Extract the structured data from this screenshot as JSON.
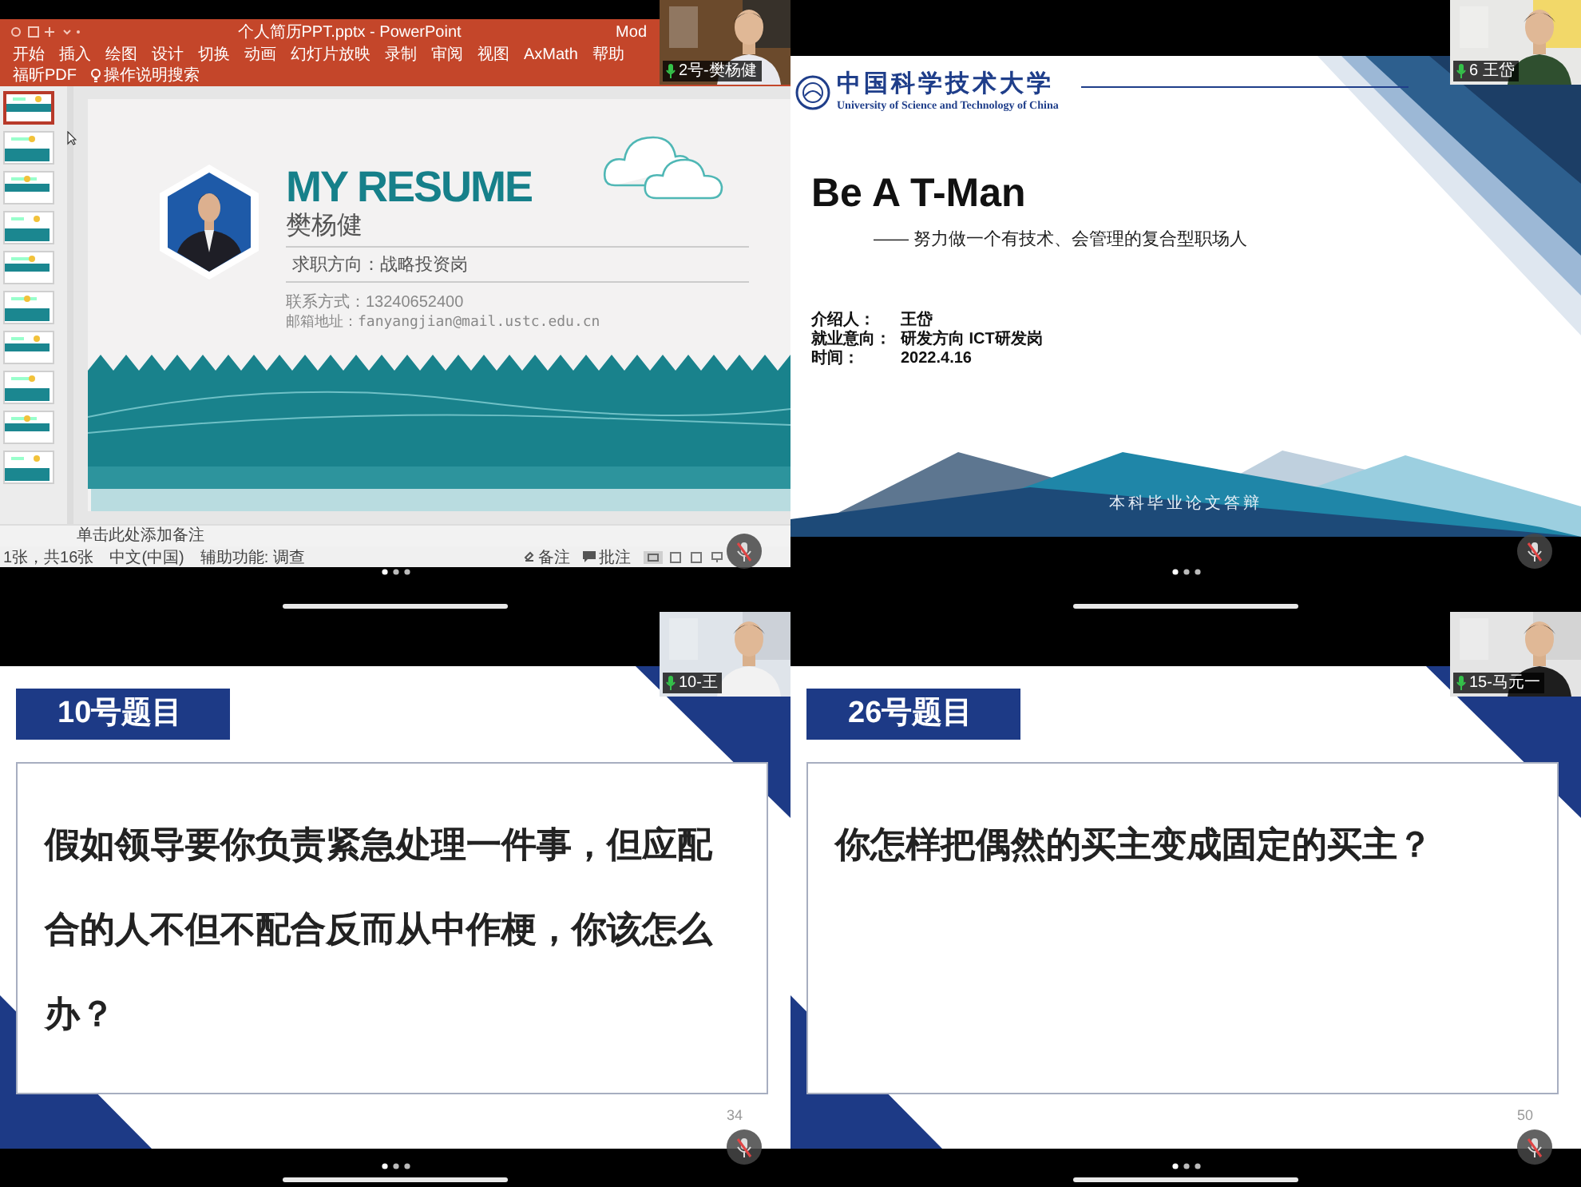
{
  "tiles": [
    {
      "kind": "powerpoint",
      "participant": {
        "name": "2号-樊杨健",
        "mic_on": true
      },
      "window": {
        "title": "个人简历PPT.pptx - PowerPoint",
        "account": "Mod"
      },
      "ribbon_tabs": [
        {
          "label": "开始",
          "kind": "tab"
        },
        {
          "label": "插入",
          "kind": "tab"
        },
        {
          "label": "绘图",
          "kind": "tab"
        },
        {
          "label": "设计",
          "kind": "tab"
        },
        {
          "label": "切换",
          "kind": "tab"
        },
        {
          "label": "动画",
          "kind": "tab"
        },
        {
          "label": "幻灯片放映",
          "kind": "tab"
        },
        {
          "label": "录制",
          "kind": "tab"
        },
        {
          "label": "审阅",
          "kind": "tab"
        },
        {
          "label": "视图",
          "kind": "tab"
        },
        {
          "label": "AxMath",
          "kind": "tab"
        },
        {
          "label": "帮助",
          "kind": "tab"
        },
        {
          "label": "福昕PDF",
          "kind": "tab"
        },
        {
          "label": "操作说明搜索",
          "kind": "search"
        }
      ],
      "slide_thumbnails": [
        {
          "selected": true
        },
        {
          "selected": false
        },
        {
          "selected": false
        },
        {
          "selected": false
        },
        {
          "selected": false
        },
        {
          "selected": false
        },
        {
          "selected": false
        },
        {
          "selected": false
        },
        {
          "selected": false
        },
        {
          "selected": false
        }
      ],
      "slide": {
        "heading": "MY RESUME",
        "name": "樊杨健",
        "objective": "求职方向：战略投资岗",
        "phone": "联系方式：13240652400",
        "email": "邮箱地址：fanyangjian@mail.ustc.edu.cn"
      },
      "notes_placeholder": "单击此处添加备注",
      "status_bar": {
        "slide_position": "1张，共16张",
        "language": "中文(中国)",
        "accessibility": "辅助功能: 调查",
        "notes": "备注",
        "comments": "批注"
      }
    },
    {
      "kind": "title_slide",
      "participant": {
        "name": "6 王岱",
        "mic_on": true
      },
      "slide": {
        "logo": {
          "name": "中国科学技术大学",
          "name_en": "University of Science and Technology of China"
        },
        "title": "Be A T-Man",
        "subtitle": "—— 努力做一个有技术、会管理的复合型职场人",
        "details": [
          {
            "label": "介绍人：",
            "value": "王岱"
          },
          {
            "label": "就业意向：",
            "value": "研发方向 ICT研发岗"
          },
          {
            "label": "时间：",
            "value": "2022.4.16"
          }
        ],
        "footer": "本科毕业论文答辩"
      }
    },
    {
      "kind": "question_slide",
      "participant": {
        "name": "10-王",
        "mic_on": true
      },
      "slide": {
        "heading": "10号题目",
        "question": "假如领导要你负责紧急处理一件事，但应配合的人不但不配合反而从中作梗，你该怎么办？",
        "page_number": "34"
      }
    },
    {
      "kind": "question_slide",
      "participant": {
        "name": "15-马元一",
        "mic_on": true
      },
      "slide": {
        "heading": "26号题目",
        "question": "你怎样把偶然的买主变成固定的买主？",
        "page_number": "50"
      }
    }
  ]
}
